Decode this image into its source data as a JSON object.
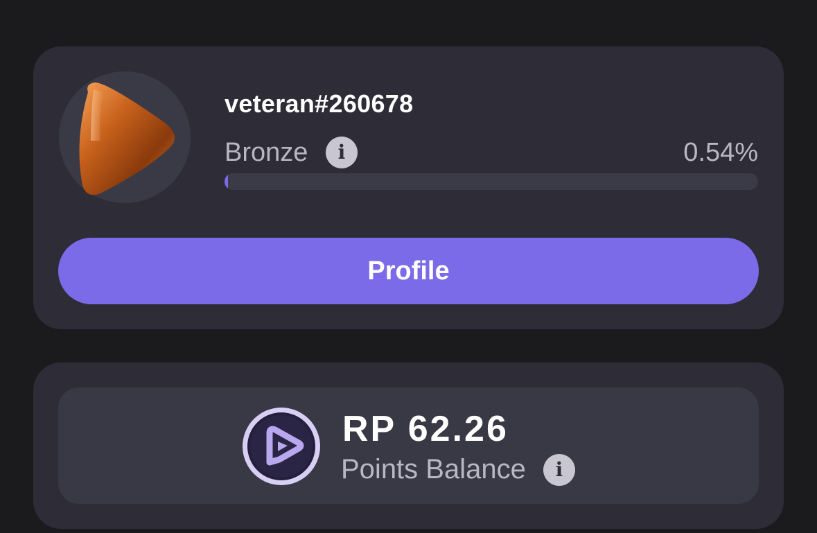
{
  "user": {
    "username": "veteran#260678",
    "tier": "Bronze",
    "progress_text": "0.54%",
    "progress_fraction": 0.0054,
    "avatar_icon": "bronze-play-badge-icon",
    "profile_button_label": "Profile"
  },
  "points": {
    "amount": "RP 62.26",
    "label": "Points Balance",
    "logo_icon": "rp-logo-icon"
  },
  "colors": {
    "background": "#1b1b1e",
    "card": "#2d2c37",
    "accent": "#7b6be8",
    "muted_text": "#b9b7c4",
    "bronze": "#c8621c"
  }
}
